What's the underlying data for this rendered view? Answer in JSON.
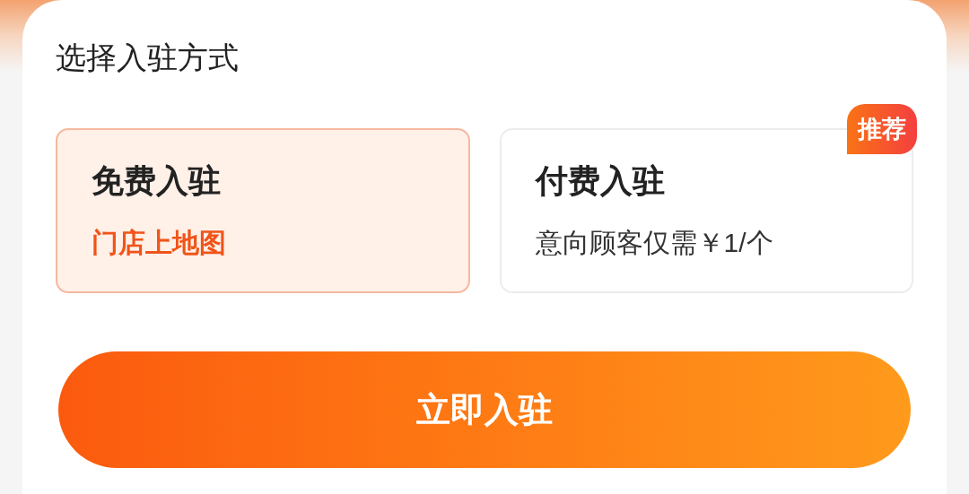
{
  "title": "选择入驻方式",
  "options": [
    {
      "name": "免费入驻",
      "desc": "门店上地图",
      "selected": true
    },
    {
      "name": "付费入驻",
      "desc": "意向顾客仅需￥1/个",
      "selected": false,
      "badge": "推荐"
    }
  ],
  "submit": "立即入驻"
}
